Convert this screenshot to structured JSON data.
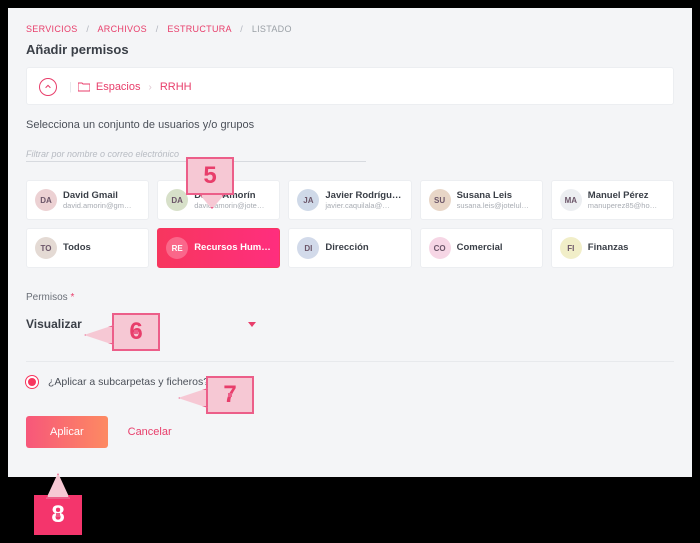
{
  "breadcrumb": {
    "items": [
      "SERVICIOS",
      "ARCHIVOS",
      "ESTRUCTURA",
      "LISTADO"
    ]
  },
  "heading": "Añadir permisos",
  "path": {
    "spaces": "Espacios",
    "current": "RRHH"
  },
  "sub": "Selecciona un conjunto de usuarios y/o grupos",
  "filter_placeholder": "Filtrar por nombre o correo electrónico",
  "users": [
    {
      "av": "DA",
      "name": "David Gmail",
      "email": "david.amorin@gm…",
      "color": "#ecd1d3"
    },
    {
      "av": "DA",
      "name": "David Amorín",
      "email": "david.amorin@jote…",
      "color": "#d7e0c9"
    },
    {
      "av": "JA",
      "name": "Javier Rodrígue…",
      "email": "javier.caquilala@…",
      "color": "#cfd9e8"
    },
    {
      "av": "SU",
      "name": "Susana Leis",
      "email": "susana.leis@jotelul…",
      "color": "#e8d6c7"
    },
    {
      "av": "MA",
      "name": "Manuel Pérez",
      "email": "manuperez85@ho…",
      "color": "#eceef1"
    }
  ],
  "groups": [
    {
      "av": "TO",
      "name": "Todos",
      "color": "#e4dad4",
      "selected": false
    },
    {
      "av": "RE",
      "name": "Recursos Huma…",
      "color": "#ffffff",
      "selected": true
    },
    {
      "av": "DI",
      "name": "Dirección",
      "color": "#d2daea",
      "selected": false
    },
    {
      "av": "CO",
      "name": "Comercial",
      "color": "#f6d6e5",
      "selected": false
    },
    {
      "av": "FI",
      "name": "Finanzas",
      "color": "#f1eec8",
      "selected": false
    }
  ],
  "perm_label": "Permisos",
  "perm_value": "Visualizar",
  "apply_sub": "¿Aplicar a subcarpetas y ficheros?",
  "btn_apply": "Aplicar",
  "btn_cancel": "Cancelar",
  "callouts": {
    "c5": "5",
    "c6": "6",
    "c7": "7",
    "c8": "8"
  }
}
